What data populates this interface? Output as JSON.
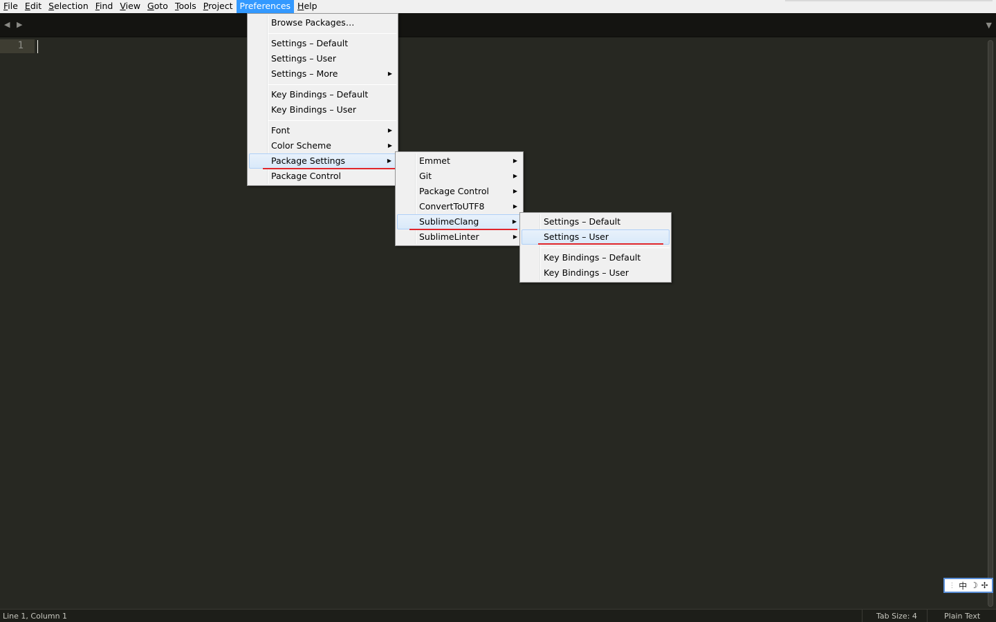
{
  "menubar": {
    "items": [
      {
        "label": "File",
        "underline": "F",
        "rest": "ile"
      },
      {
        "label": "Edit",
        "underline": "E",
        "rest": "dit"
      },
      {
        "label": "Selection",
        "underline": "S",
        "rest": "election"
      },
      {
        "label": "Find",
        "underline": "F",
        "rest": "ind"
      },
      {
        "label": "View",
        "underline": "V",
        "rest": "iew"
      },
      {
        "label": "Goto",
        "underline": "G",
        "rest": "oto"
      },
      {
        "label": "Tools",
        "underline": "T",
        "rest": "ools"
      },
      {
        "label": "Project",
        "underline": "P",
        "rest": "roject"
      },
      {
        "label": "Preferences",
        "underline": "",
        "rest": "Preferences"
      },
      {
        "label": "Help",
        "underline": "H",
        "rest": "elp"
      }
    ]
  },
  "tabbar": {
    "nav_icons": "◀ ▶",
    "dropdown_icon": "▼"
  },
  "editor": {
    "line_number": "1"
  },
  "preferences_menu": {
    "browse_packages": "Browse Packages…",
    "settings_default": "Settings – Default",
    "settings_user": "Settings – User",
    "settings_more": "Settings – More",
    "key_bindings_default": "Key Bindings – Default",
    "key_bindings_user": "Key Bindings – User",
    "font": "Font",
    "color_scheme": "Color Scheme",
    "package_settings": "Package Settings",
    "package_control": "Package Control"
  },
  "package_settings_menu": {
    "emmet": "Emmet",
    "git": "Git",
    "package_control": "Package Control",
    "convert_to_utf8": "ConvertToUTF8",
    "sublime_clang": "SublimeClang",
    "sublime_linter": "SublimeLinter"
  },
  "sublime_clang_menu": {
    "settings_default": "Settings – Default",
    "settings_user": "Settings – User",
    "key_bindings_default": "Key Bindings – Default",
    "key_bindings_user": "Key Bindings – User"
  },
  "statusbar": {
    "position": "Line 1, Column 1",
    "tab_size": "Tab Size: 4",
    "syntax": "Plain Text"
  },
  "ime": {
    "mode": "中",
    "moon": "☽",
    "punct": "✢"
  },
  "colors": {
    "editor_bg": "#272822",
    "menu_bg": "#f0f0f0",
    "menubar_active": "#3399ff",
    "annotation_red": "#e0252b"
  }
}
